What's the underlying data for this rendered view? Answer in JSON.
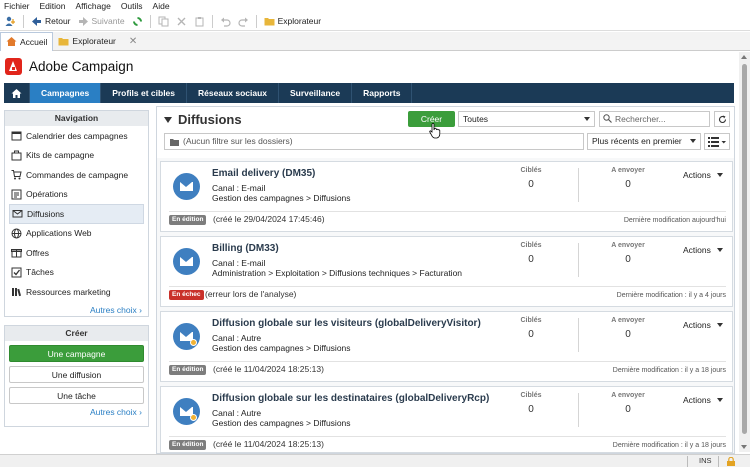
{
  "menubar": {
    "items": [
      "Fichier",
      "Edition",
      "Affichage",
      "Outils",
      "Aide"
    ]
  },
  "toolbar": {
    "back": "Retour",
    "next": "Suivante",
    "explorer": "Explorateur"
  },
  "tabs": [
    {
      "label": "Accueil"
    },
    {
      "label": "Explorateur"
    }
  ],
  "brand": {
    "name": "Adobe Campaign",
    "color": "#e1251b"
  },
  "nav": {
    "items": [
      "Campagnes",
      "Profils et cibles",
      "Réseaux sociaux",
      "Surveillance",
      "Rapports"
    ],
    "active": "Campagnes",
    "bg": "#1b3a56",
    "active_bg": "#2a7fc4"
  },
  "sidebar": {
    "navigation_title": "Navigation",
    "items": [
      {
        "label": "Calendrier des campagnes",
        "icon": "calendar-icon"
      },
      {
        "label": "Kits de campagne",
        "icon": "kit-icon"
      },
      {
        "label": "Commandes de campagne",
        "icon": "cart-icon"
      },
      {
        "label": "Opérations",
        "icon": "operations-icon"
      },
      {
        "label": "Diffusions",
        "icon": "envelope-icon"
      },
      {
        "label": "Applications Web",
        "icon": "globe-icon"
      },
      {
        "label": "Offres",
        "icon": "offer-icon"
      },
      {
        "label": "Tâches",
        "icon": "checkbox-icon"
      },
      {
        "label": "Ressources marketing",
        "icon": "resources-icon"
      }
    ],
    "more": "Autres choix",
    "create_title": "Créer",
    "create_buttons": [
      "Une campagne",
      "Une diffusion",
      "Une tâche"
    ],
    "create_more": "Autres choix"
  },
  "main": {
    "title": "Diffusions",
    "create_label": "Créer",
    "type_filter": "Toutes",
    "search_placeholder": "Rechercher...",
    "folder_filter": "(Aucun filtre sur les dossiers)",
    "sort": "Plus récents en premier"
  },
  "cards": [
    {
      "title": "Email delivery (DM35)",
      "channel_label": "Canal : ",
      "channel": "E-mail",
      "path": "Gestion des campagnes > Diffusions",
      "targeted_label": "Ciblés",
      "targeted": "0",
      "to_send_label": "A envoyer",
      "to_send": "0",
      "actions": "Actions",
      "status": "En édition",
      "status_type": "edit",
      "note": "(créé le 29/04/2024 17:45:46)",
      "last_mod": "Dernière modification aujourd'hui",
      "gear": false
    },
    {
      "title": "Billing (DM33)",
      "channel_label": "Canal : ",
      "channel": "E-mail",
      "path": "Administration > Exploitation > Diffusions techniques > Facturation",
      "targeted_label": "Ciblés",
      "targeted": "0",
      "to_send_label": "A envoyer",
      "to_send": "0",
      "actions": "Actions",
      "status": "En échec",
      "status_type": "fail",
      "note": "(erreur lors de l'analyse)",
      "last_mod": "Dernière modification : il y a 4 jours",
      "gear": false
    },
    {
      "title": "Diffusion globale sur les visiteurs (globalDeliveryVisitor)",
      "channel_label": "Canal : ",
      "channel": "Autre",
      "path": "Gestion des campagnes > Diffusions",
      "targeted_label": "Ciblés",
      "targeted": "0",
      "to_send_label": "A envoyer",
      "to_send": "0",
      "actions": "Actions",
      "status": "En édition",
      "status_type": "edit",
      "note": "(créé le 11/04/2024 18:25:13)",
      "last_mod": "Dernière modification : il y a 18 jours",
      "gear": true
    },
    {
      "title": "Diffusion globale sur les destinataires (globalDeliveryRcp)",
      "channel_label": "Canal : ",
      "channel": "Autre",
      "path": "Gestion des campagnes > Diffusions",
      "targeted_label": "Ciblés",
      "targeted": "0",
      "to_send_label": "A envoyer",
      "to_send": "0",
      "actions": "Actions",
      "status": "En édition",
      "status_type": "edit",
      "note": "(créé le 11/04/2024 18:25:13)",
      "last_mod": "Dernière modification : il y a 18 jours",
      "gear": true
    }
  ],
  "statusbar": {
    "mode": "INS"
  }
}
